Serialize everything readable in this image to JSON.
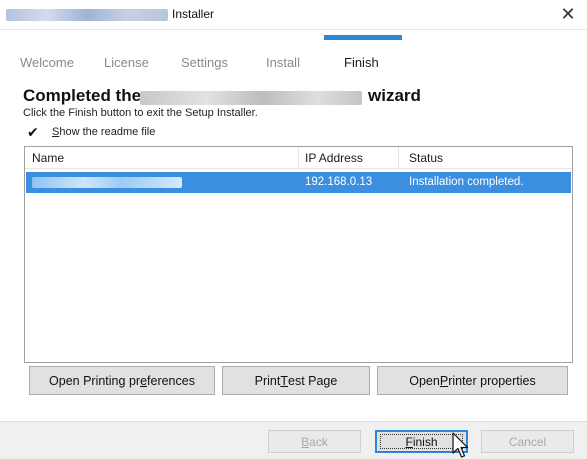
{
  "window": {
    "title": "Installer",
    "close_glyph": "✕"
  },
  "steps": [
    {
      "label": "Welcome"
    },
    {
      "label": "License"
    },
    {
      "label": "Settings"
    },
    {
      "label": "Install"
    },
    {
      "label": "Finish"
    }
  ],
  "active_step": "Finish",
  "heading": {
    "prefix": "Completed the",
    "suffix": "wizard"
  },
  "instructions": "Click the Finish button to exit the Setup Installer.",
  "readme": {
    "checked": true,
    "check_glyph": "✔",
    "label_mnemonic": "S",
    "label_rest": "how the readme file"
  },
  "table": {
    "columns": [
      "Name",
      "IP Address",
      "Status"
    ],
    "rows": [
      {
        "ip": "192.168.0.13",
        "status": "Installation completed.",
        "selected": true
      }
    ]
  },
  "actions": {
    "prefs_before": "Open Printing pr",
    "prefs_mnemonic": "e",
    "prefs_after": "ferences",
    "test_before": "Print ",
    "test_mnemonic": "T",
    "test_after": "est Page",
    "props_before": "Open ",
    "props_mnemonic": "P",
    "props_after": "rinter properties"
  },
  "footer": {
    "back_mnemonic": "B",
    "back_rest": "ack",
    "finish_mnemonic": "F",
    "finish_rest": "inish",
    "cancel": "Cancel"
  },
  "colors": {
    "accent": "#2e86d7",
    "selection": "#3a8fe0"
  },
  "icons": [
    "close-icon",
    "checkmark-icon",
    "mouse-pointer-icon"
  ]
}
